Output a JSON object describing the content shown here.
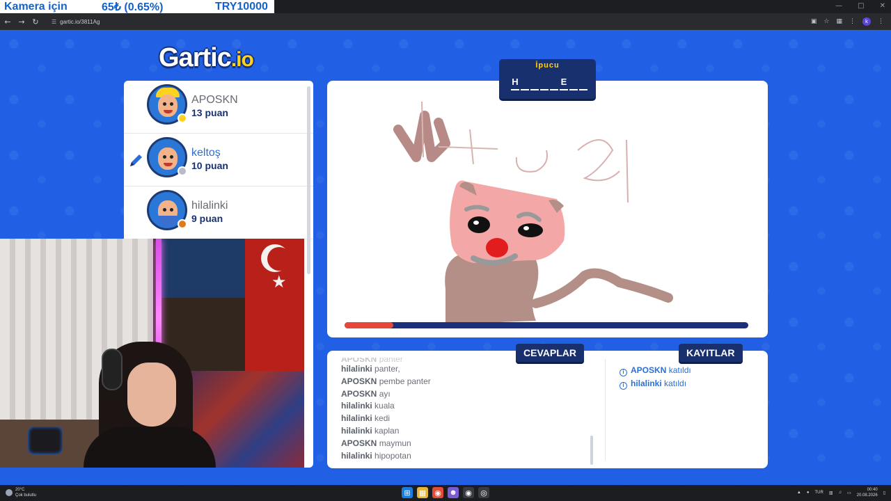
{
  "overlay": {
    "label": "Kamera için",
    "price": "65₺ (0.65%)",
    "goal": "TRY10000"
  },
  "browser": {
    "url": "gartic.io/3811Ag",
    "profile_initial": "k"
  },
  "logo": {
    "main": "Gartic",
    "suffix": ".io"
  },
  "hint": {
    "title": "İpucu",
    "letters": [
      "H",
      "",
      "",
      "",
      "",
      "E",
      "",
      ""
    ]
  },
  "players": [
    {
      "name": "APOSKN",
      "score": "13 puan",
      "drawing": false,
      "dot_color": "#ffd21f"
    },
    {
      "name": "keltoş",
      "score": "10 puan",
      "drawing": true,
      "dot_color": "#b7bcc6"
    },
    {
      "name": "hilalinki",
      "score": "9 puan",
      "drawing": false,
      "dot_color": "#e07a1d"
    }
  ],
  "timer": {
    "progress_fraction": 0.12
  },
  "tabs": {
    "answers": "CEVAPLAR",
    "logs": "KAYITLAR"
  },
  "answers": [
    {
      "user": "APOSKN",
      "text": "panter",
      "cut": true
    },
    {
      "user": "hilalinki",
      "text": "panter,"
    },
    {
      "user": "APOSKN",
      "text": "pembe panter"
    },
    {
      "user": "APOSKN",
      "text": "ayı"
    },
    {
      "user": "hilalinki",
      "text": "kuala"
    },
    {
      "user": "hilalinki",
      "text": "kedi"
    },
    {
      "user": "hilalinki",
      "text": "kaplan"
    },
    {
      "user": "APOSKN",
      "text": "maymun"
    },
    {
      "user": "hilalinki",
      "text": "hipopotan"
    }
  ],
  "logs": [
    {
      "user": "APOSKN",
      "text": "katıldı"
    },
    {
      "user": "hilalinki",
      "text": "katıldı"
    }
  ],
  "taskbar": {
    "temperature": "20°C",
    "weather": "Çok bulutlu",
    "lang": "TUR",
    "time": "00:40",
    "date": "20.08.2026"
  },
  "colors": {
    "page_bg": "#2160e5",
    "navy": "#18306e",
    "hint_yellow": "#ffd21f",
    "timer_red": "#e6473a"
  }
}
